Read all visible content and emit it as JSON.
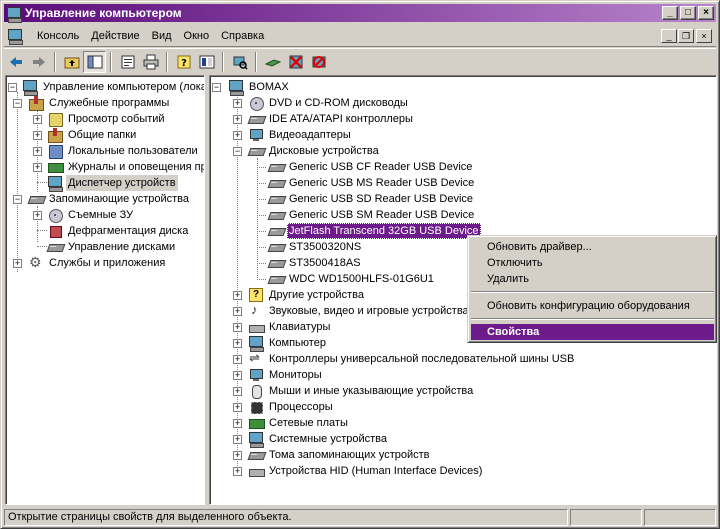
{
  "window": {
    "title": "Управление компьютером",
    "buttons": {
      "minimize": "_",
      "maximize": "□",
      "close": "×"
    }
  },
  "menubar": {
    "items": [
      "Консоль",
      "Действие",
      "Вид",
      "Окно",
      "Справка"
    ],
    "mdi": {
      "minimize": "_",
      "restore": "❐",
      "close": "×"
    }
  },
  "toolbar": {
    "icons": [
      "back-arrow-icon",
      "forward-arrow-icon",
      "up-folder-icon",
      "show-tree-icon",
      "properties-icon",
      "print-icon",
      "help-icon",
      "view-icon",
      "scan-hardware-icon",
      "uninstall-icon",
      "disable-device-icon",
      "update-driver-icon"
    ]
  },
  "left_tree": {
    "root": "Управление компьютером (локаль",
    "items": [
      "Служебные программы",
      "Просмотр событий",
      "Общие папки",
      "Локальные пользователи",
      "Журналы и оповещения пр",
      "Диспетчер устройств",
      "Запоминающие устройства",
      "Съемные ЗУ",
      "Дефрагментация диска",
      "Управление дисками",
      "Службы и приложения"
    ]
  },
  "right_tree": {
    "root": "BOMAX",
    "categories_top": [
      "DVD и CD-ROM дисководы",
      "IDE ATA/ATAPI контроллеры",
      "Видеоадаптеры",
      "Дисковые устройства"
    ],
    "disks": [
      "Generic USB CF Reader USB Device",
      "Generic USB MS Reader USB Device",
      "Generic USB SD Reader USB Device",
      "Generic USB SM Reader USB Device",
      "JetFlash Transcend 32GB USB Device",
      "ST3500320NS",
      "ST3500418AS",
      "WDC WD1500HLFS-01G6U1"
    ],
    "categories_bottom": [
      "Другие устройства",
      "Звуковые, видео и игровые устройства",
      "Клавиатуры",
      "Компьютер",
      "Контроллеры универсальной последовательной шины USB",
      "Мониторы",
      "Мыши и иные указывающие устройства",
      "Процессоры",
      "Сетевые платы",
      "Системные устройства",
      "Тома запоминающих устройств",
      "Устройства HID (Human Interface Devices)"
    ]
  },
  "context_menu": {
    "update_driver": "Обновить драйвер...",
    "disable": "Отключить",
    "remove": "Удалить",
    "scan_hardware": "Обновить конфигурацию оборудования",
    "properties": "Свойства"
  },
  "statusbar": {
    "text": "Открытие страницы свойств для выделенного объекта."
  },
  "colors": {
    "titlebar_start": "#5a0b7a",
    "titlebar_end": "#b884cc",
    "selection": "#6d1a8a",
    "chrome": "#d4d0c8"
  }
}
